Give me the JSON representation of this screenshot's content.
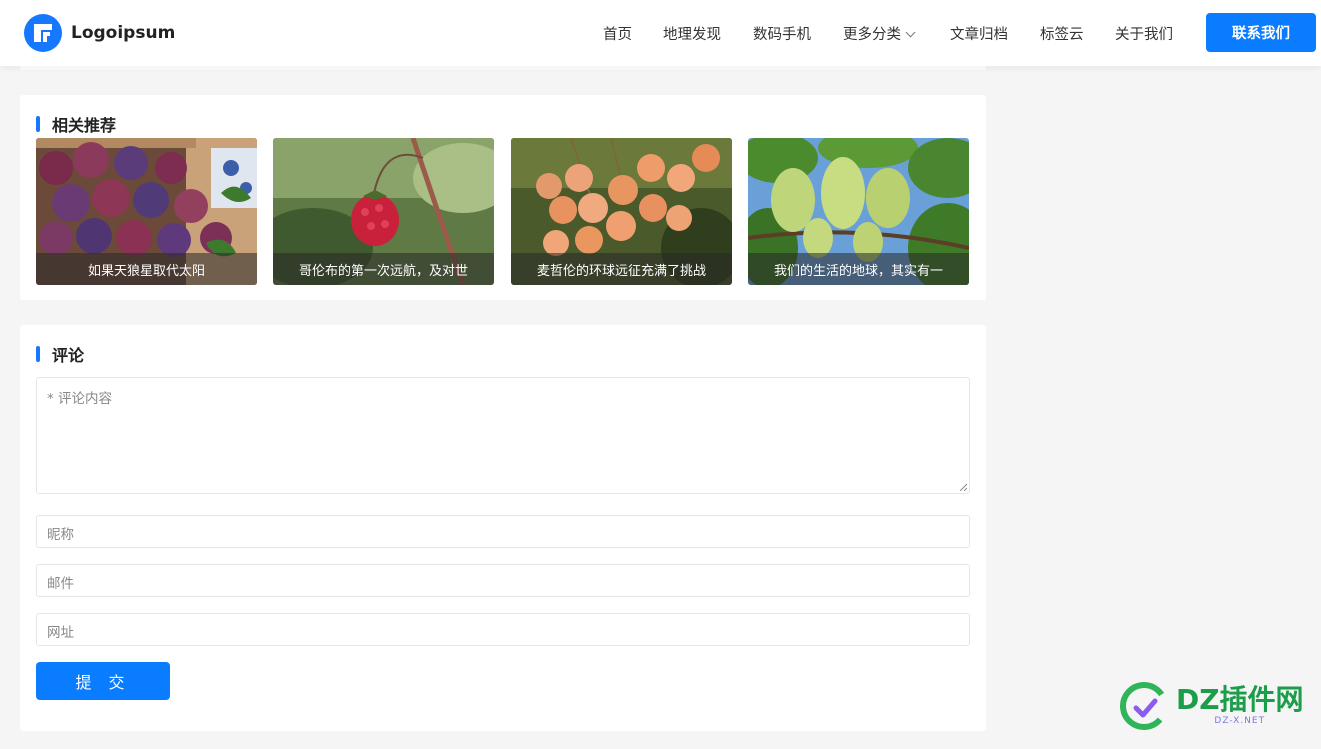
{
  "header": {
    "logo_text": "Logoipsum",
    "nav": [
      {
        "label": "首页"
      },
      {
        "label": "地理发现"
      },
      {
        "label": "数码手机"
      },
      {
        "label": "更多分类"
      },
      {
        "label": "文章归档"
      },
      {
        "label": "标签云"
      },
      {
        "label": "关于我们"
      }
    ],
    "contact_button": "联系我们",
    "accent_color": "#0a7cff"
  },
  "related": {
    "title": "相关推荐",
    "items": [
      {
        "caption": "如果天狼星取代太阳",
        "image": "plums-photo"
      },
      {
        "caption": "哥伦布的第一次远航，及对世",
        "image": "raspberry-photo"
      },
      {
        "caption": "麦哲伦的环球远征充满了挑战",
        "image": "currants-photo"
      },
      {
        "caption": "我们的生活的地球，其实有一",
        "image": "grapes-photo"
      }
    ]
  },
  "comments": {
    "title": "评论",
    "content_placeholder": "* 评论内容",
    "nickname_placeholder": "昵称",
    "email_placeholder": "邮件",
    "website_placeholder": "网址",
    "submit_label": "提 交"
  },
  "watermark": {
    "main": "DZ插件网",
    "sub": "DZ-X.NET"
  }
}
